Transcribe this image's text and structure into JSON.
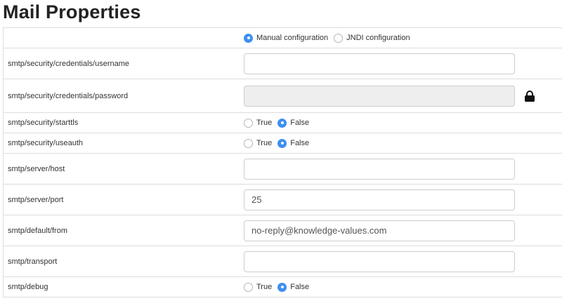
{
  "page": {
    "title": "Mail Properties"
  },
  "config_mode": {
    "options": [
      {
        "label": "Manual configuration",
        "checked": true
      },
      {
        "label": "JNDI configuration",
        "checked": false
      }
    ]
  },
  "rows": {
    "username": {
      "label": "smtp/security/credentials/username",
      "value": ""
    },
    "password": {
      "label": "smtp/security/credentials/password",
      "value": "",
      "icon": "lock-icon"
    },
    "starttls": {
      "label": "smtp/security/starttls",
      "true_label": "True",
      "false_label": "False",
      "selected": "False"
    },
    "useauth": {
      "label": "smtp/security/useauth",
      "true_label": "True",
      "false_label": "False",
      "selected": "False"
    },
    "host": {
      "label": "smtp/server/host",
      "value": ""
    },
    "port": {
      "label": "smtp/server/port",
      "value": "25"
    },
    "from": {
      "label": "smtp/default/from",
      "value": "no-reply@knowledge-values.com"
    },
    "transport": {
      "label": "smtp/transport",
      "value": ""
    },
    "debug": {
      "label": "smtp/debug",
      "true_label": "True",
      "false_label": "False",
      "selected": "False"
    }
  },
  "colors": {
    "accent": "#3d8ff0",
    "border": "#dddddd",
    "disabled_bg": "#eeeeee"
  }
}
